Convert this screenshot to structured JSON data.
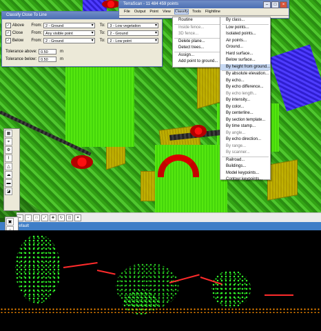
{
  "classify_window": {
    "title": "Classify Close To Line",
    "rows": [
      {
        "label": "Above",
        "from_label": "From:",
        "from": "2 - Ground",
        "to_label": "To:",
        "to": "3 - Low vegetation"
      },
      {
        "label": "Close",
        "from_label": "From:",
        "from": "Any visible point",
        "to_label": "To:",
        "to": "2 - Ground"
      },
      {
        "label": "Below",
        "from_label": "From:",
        "from": "2 - Ground",
        "to_label": "To:",
        "to": "2 - Low point"
      }
    ],
    "tolerance_above_label": "Tolerance above:",
    "tolerance_above": "0.50",
    "tolerance_below_label": "Tolerance below:",
    "tolerance_below": "0.50",
    "unit": "m"
  },
  "terrascan_window": {
    "title": "TerraScan - 11 484 459 points",
    "menu": [
      "File",
      "Output",
      "Point",
      "View",
      "Classify",
      "Tools",
      "Flightline"
    ],
    "left_menu": [
      "Routine",
      "Inside fence...",
      "3D fence...",
      "Delete plane...",
      "Detect trees...",
      "Assign...",
      "Add point to ground..."
    ],
    "classify_menu": [
      "By class...",
      "Low points...",
      "Isolated points...",
      "Air points...",
      "Ground...",
      "Hard surface...",
      "Below surface...",
      "By height from ground...",
      "By absolute elevation...",
      "By echo...",
      "By echo difference...",
      "By echo length...",
      "By intensity...",
      "By color...",
      "By centerline...",
      "By section template...",
      "By time stamp...",
      "By angle...",
      "By echo direction...",
      "By range...",
      "By scanner...",
      "Railroad...",
      "Buildings...",
      "Model keypoints...",
      "Contour keypoints..."
    ]
  },
  "lower_view": {
    "title": "Default"
  },
  "colors": {
    "accent": "#3f7ec7",
    "menu_highlight": "#c6d8f2",
    "line": "#ff2b2b"
  }
}
